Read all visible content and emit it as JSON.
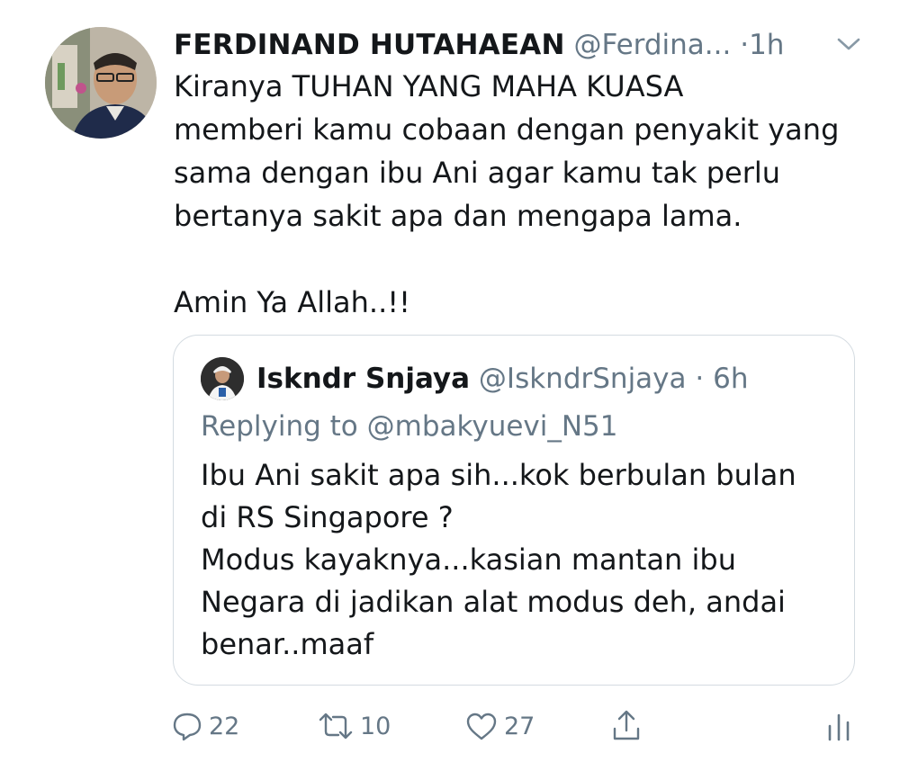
{
  "tweet": {
    "author_name": "FERDINAND HUTAHAEAN",
    "author_handle": "@Ferdina...",
    "separator": "·",
    "time": "1h",
    "lines": [
      "Kiranya TUHAN YANG MAHA KUASA",
      "memberi kamu cobaan dengan penyakit yang",
      "sama dengan ibu Ani agar kamu tak perlu",
      "bertanya sakit apa dan mengapa lama."
    ],
    "closing": "Amin Ya Allah..!!"
  },
  "quote": {
    "author_name": "Iskndr Snjaya",
    "author_handle": "@IskndrSnjaya",
    "separator": "·",
    "time": "6h",
    "replying_to": "Replying to @mbakyuevi_N51",
    "lines": [
      "Ibu Ani sakit apa sih...kok berbulan bulan",
      "di RS Singapore ?",
      "Modus kayaknya...kasian mantan ibu",
      "Negara di jadikan alat modus deh, andai",
      "benar..maaf"
    ]
  },
  "actions": {
    "reply_count": "22",
    "retweet_count": "10",
    "like_count": "27"
  },
  "icons": {
    "reply": "speech-bubble-icon",
    "retweet": "retweet-arrows-icon",
    "like": "heart-icon",
    "share": "share-upload-icon",
    "analytics": "analytics-bars-icon",
    "menu": "chevron-down-icon"
  },
  "colors": {
    "text_primary": "#14171a",
    "text_secondary": "#657786",
    "border": "#d4dbe1",
    "icon": "#657786"
  }
}
